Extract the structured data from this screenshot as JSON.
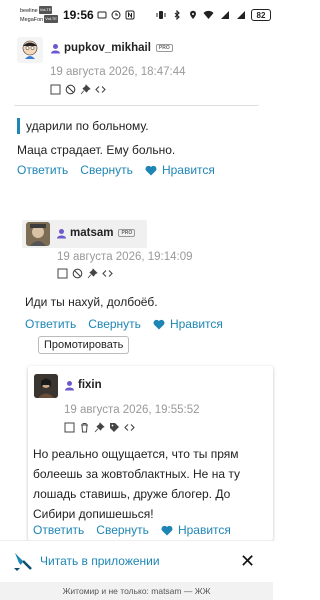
{
  "status_bar": {
    "carrier1": "beeline",
    "carrier1_tag": "VoLTE",
    "carrier2": "MegaFon",
    "carrier2_tag": "VoLTE",
    "time": "19:56",
    "battery": "82"
  },
  "comments": [
    {
      "username": "pupkov_mikhail",
      "badge": "PRO",
      "date": "19 августа 2026, 18:47:44"
    },
    {
      "quote": "ударили по больному.",
      "text": "Маца страдает. Ему больно.",
      "reply": "Ответить",
      "collapse": "Свернуть",
      "like": "Нравится"
    },
    {
      "username": "matsam",
      "badge": "PRO",
      "date": "19 августа 2026, 19:14:09",
      "text": "Иди ты нахуй, долбоёб.",
      "reply": "Ответить",
      "collapse": "Свернуть",
      "like": "Нравится",
      "promote": "Промотировать"
    },
    {
      "username": "fixin",
      "date": "19 августа 2026, 19:55:52",
      "text_lines": [
        "Но реально ощущается, что ты прям",
        "болеешь за жовтоблактных. Не на ту",
        "лошадь ставишь, друже блогер. До",
        "Сибири допишешься!"
      ],
      "reply": "Ответить",
      "collapse": "Свернуть",
      "like": "Нравится"
    }
  ],
  "bottom_bar": {
    "open_in_app": "Читать в приложении",
    "close": "✕"
  },
  "footer": {
    "text": "Житомир и не только: matsam — ЖЖ"
  },
  "colors": {
    "link": "#1d86b5",
    "date": "#999999"
  }
}
